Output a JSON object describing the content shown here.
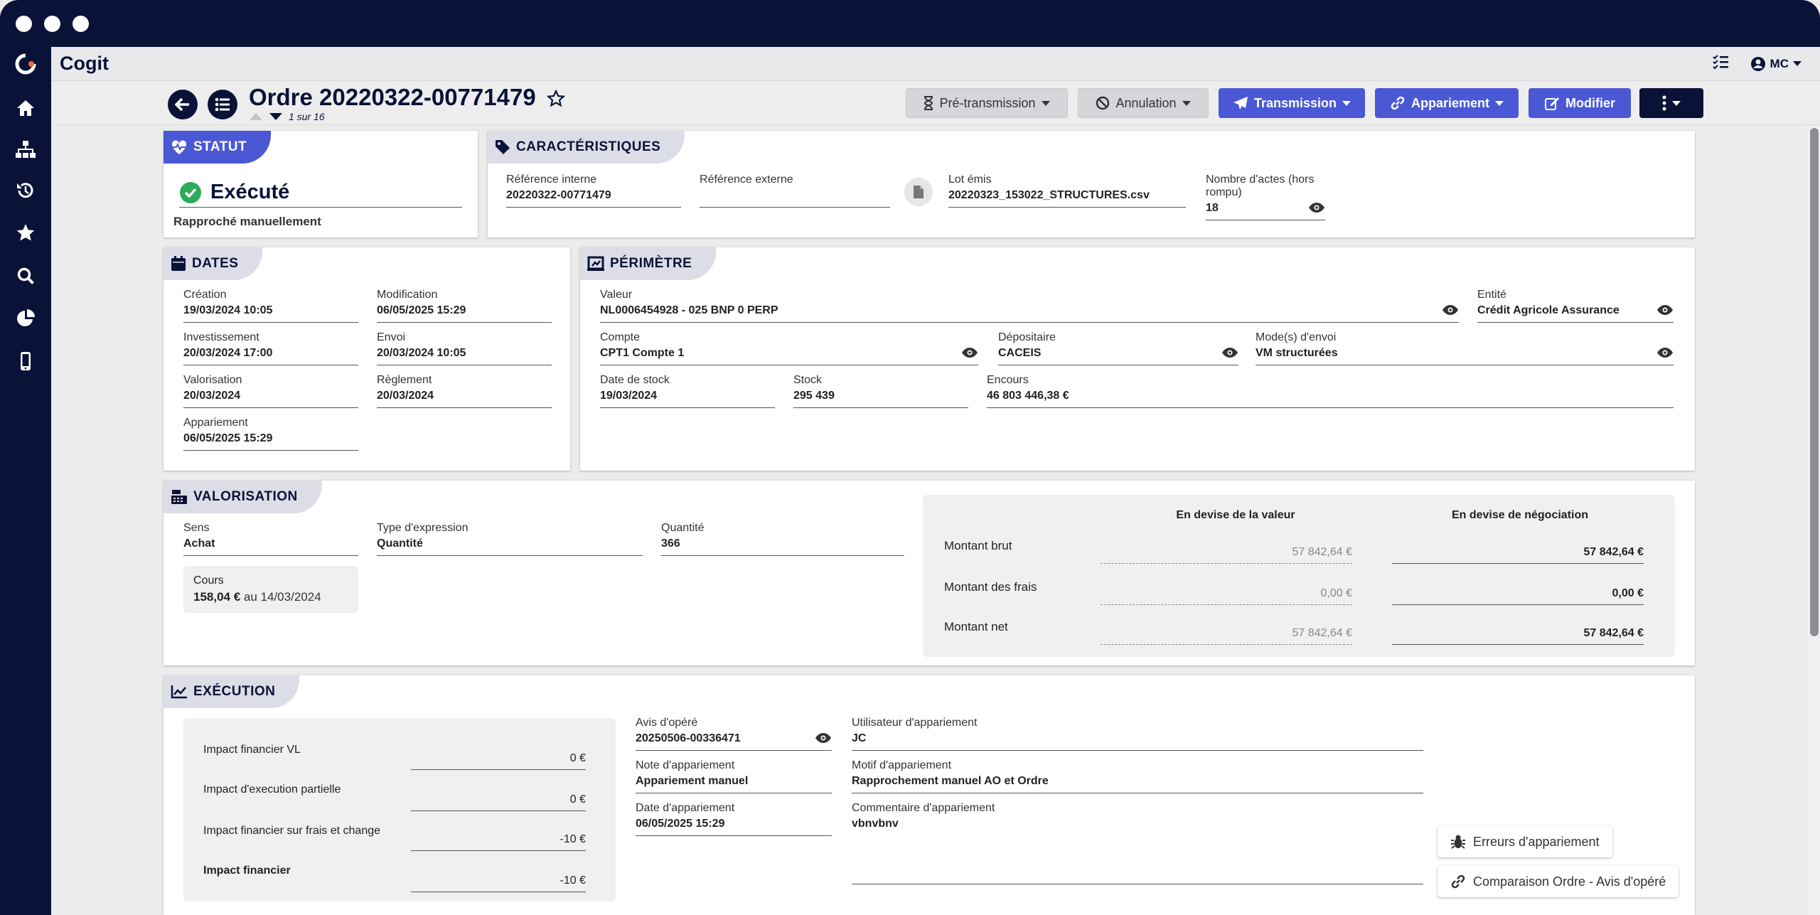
{
  "app": {
    "name": "Cogit",
    "user_initials": "MC"
  },
  "header": {
    "title": "Ordre 20220322-00771479",
    "pager": "1 sur 16",
    "buttons": {
      "pretransmission": "Pré-transmission",
      "annulation": "Annulation",
      "transmission": "Transmission",
      "appariement": "Appariement",
      "modifier": "Modifier"
    }
  },
  "statut": {
    "title": "STATUT",
    "value": "Exécuté",
    "subtext": "Rapproché manuellement",
    "color": "#2eaa5a"
  },
  "caracteristiques": {
    "title": "CARACTÉRISTIQUES",
    "ref_interne_label": "Référence interne",
    "ref_interne": "20220322-00771479",
    "ref_externe_label": "Référence externe",
    "ref_externe": "",
    "lot_label": "Lot émis",
    "lot": "20220323_153022_STRUCTURES.csv",
    "nb_actes_label": "Nombre d'actes (hors rompu)",
    "nb_actes": "18"
  },
  "dates": {
    "title": "DATES",
    "creation_label": "Création",
    "creation": "19/03/2024 10:05",
    "modification_label": "Modification",
    "modification": "06/05/2025 15:29",
    "investissement_label": "Investissement",
    "investissement": "20/03/2024 17:00",
    "envoi_label": "Envoi",
    "envoi": "20/03/2024 10:05",
    "valorisation_label": "Valorisation",
    "valorisation": "20/03/2024",
    "reglement_label": "Règlement",
    "reglement": "20/03/2024",
    "appariement_label": "Appariement",
    "appariement": "06/05/2025 15:29"
  },
  "perimetre": {
    "title": "PÉRIMÈTRE",
    "valeur_label": "Valeur",
    "valeur": "NL0006454928 - 025 BNP 0 PERP",
    "entite_label": "Entité",
    "entite": "Crédit Agricole Assurance",
    "compte_label": "Compte",
    "compte": "CPT1 Compte 1",
    "depositaire_label": "Dépositaire",
    "depositaire": "CACEIS",
    "modes_label": "Mode(s) d'envoi",
    "modes": "VM structurées",
    "date_stock_label": "Date de stock",
    "date_stock": "19/03/2024",
    "stock_label": "Stock",
    "stock": "295 439",
    "encours_label": "Encours",
    "encours": "46 803 446,38 €"
  },
  "valorisation": {
    "title": "VALORISATION",
    "sens_label": "Sens",
    "sens": "Achat",
    "type_label": "Type d'expression",
    "type": "Quantité",
    "quantite_label": "Quantité",
    "quantite": "366",
    "cours_label": "Cours",
    "cours_value": "158,04 €",
    "cours_date": "au 14/03/2024",
    "col_valeur": "En devise de la valeur",
    "col_negociation": "En devise de négociation",
    "rows": [
      {
        "label": "Montant brut",
        "valeur": "57 842,64 €",
        "negociation": "57 842,64 €"
      },
      {
        "label": "Montant des frais",
        "valeur": "0,00 €",
        "negociation": "0,00 €"
      },
      {
        "label": "Montant net",
        "valeur": "57 842,64 €",
        "negociation": "57 842,64 €"
      }
    ]
  },
  "execution": {
    "title": "EXÉCUTION",
    "impacts": [
      {
        "label": "Impact financier VL",
        "value": "0 €"
      },
      {
        "label": "Impact d'execution partielle",
        "value": "0 €"
      },
      {
        "label": "Impact financier sur frais et change",
        "value": "-10 €"
      },
      {
        "label": "Impact financier",
        "value": "-10 €"
      }
    ],
    "avis_label": "Avis d'opéré",
    "avis": "20250506-00336471",
    "note_label": "Note d'appariement",
    "note": "Appariement manuel",
    "date_app_label": "Date d'appariement",
    "date_app": "06/05/2025 15:29",
    "utilisateur_label": "Utilisateur d'appariement",
    "utilisateur": "JC",
    "motif_label": "Motif d'appariement",
    "motif": "Rapprochement manuel AO et Ordre",
    "commentaire_label": "Commentaire d'appariement",
    "commentaire": "vbnvbnv",
    "btn_erreurs": "Erreurs d'appariement",
    "btn_comparaison": "Comparaison Ordre - Avis d'opéré"
  },
  "colors": {
    "navy": "#0b1238",
    "accent": "#4a58d6",
    "success": "#2eaa5a"
  }
}
